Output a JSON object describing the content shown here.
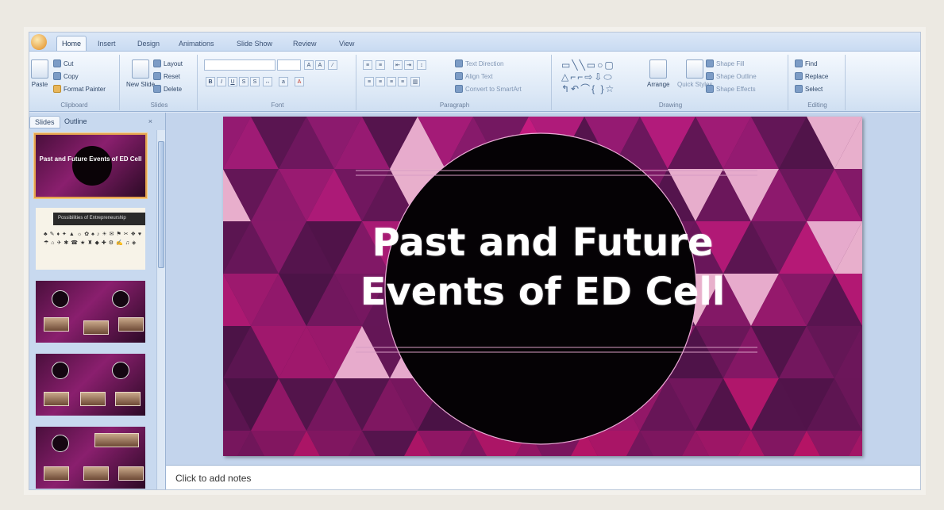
{
  "ribbon": {
    "tabs": [
      "Home",
      "Insert",
      "Design",
      "Animations",
      "Slide Show",
      "Review",
      "View"
    ],
    "active_tab": "Home",
    "clipboard": {
      "paste": "Paste",
      "cut": "Cut",
      "copy": "Copy",
      "format_painter": "Format Painter",
      "label": "Clipboard"
    },
    "slides": {
      "new_slide": "New Slide",
      "layout": "Layout",
      "reset": "Reset",
      "delete": "Delete",
      "label": "Slides"
    },
    "font": {
      "label": "Font"
    },
    "paragraph": {
      "text_direction": "Text Direction",
      "align_text": "Align Text",
      "convert": "Convert to SmartArt",
      "label": "Paragraph"
    },
    "drawing": {
      "arrange": "Arrange",
      "quick_styles": "Quick Styles",
      "shape_fill": "Shape Fill",
      "shape_outline": "Shape Outline",
      "shape_effects": "Shape Effects",
      "label": "Drawing"
    },
    "editing": {
      "find": "Find",
      "replace": "Replace",
      "select": "Select",
      "label": "Editing"
    }
  },
  "panel": {
    "tabs": [
      "Slides",
      "Outline"
    ],
    "close": "×",
    "thumb1_text": "Past and Future Events of ED Cell",
    "thumb2_text": "Possibilities of Entrepreneurship"
  },
  "slide": {
    "title_line1": "Past and Future",
    "title_line2": "Events of ED Cell"
  },
  "notes": {
    "placeholder": "Click to add notes"
  }
}
